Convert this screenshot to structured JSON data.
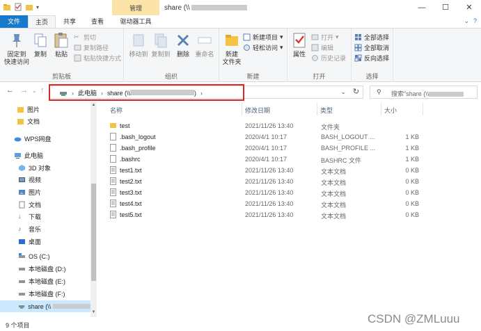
{
  "title": {
    "path_prefix": "share (\\\\",
    "context_tab": "管理"
  },
  "window_controls": {
    "minimize": "—",
    "maximize": "☐",
    "close": "✕"
  },
  "tabs": [
    {
      "label": "文件"
    },
    {
      "label": "主页"
    },
    {
      "label": "共享"
    },
    {
      "label": "查看"
    },
    {
      "label": "驱动器工具"
    }
  ],
  "ribbon": {
    "clipboard": {
      "label": "剪贴板",
      "pin": "固定到\n快速访问",
      "pin_line1": "固定到",
      "pin_line2": "快速访问",
      "copy": "复制",
      "paste": "粘贴",
      "cut": "剪切",
      "copy_path": "复制路径",
      "paste_shortcut": "粘贴快捷方式"
    },
    "organize": {
      "label": "组织",
      "move_to": "移动到",
      "copy_to": "复制到",
      "delete": "删除",
      "rename": "重命名"
    },
    "new": {
      "label": "新建",
      "new_folder_line1": "新建",
      "new_folder_line2": "文件夹",
      "new_item": "新建项目",
      "easy_access": "轻松访问"
    },
    "open": {
      "label": "打开",
      "properties": "属性",
      "open": "打开",
      "edit": "编辑",
      "history": "历史记录"
    },
    "select": {
      "label": "选择",
      "select_all": "全部选择",
      "select_none": "全部取消",
      "invert": "反向选择"
    }
  },
  "address": {
    "this_pc": "此电脑",
    "share": "share (\\\\",
    "tail": ")"
  },
  "search": {
    "placeholder": "搜索\"share (\\\\"
  },
  "nav": [
    {
      "label": "图片",
      "icon": "folder-pin-icon"
    },
    {
      "label": "文档",
      "icon": "folder-pin-icon"
    },
    {
      "label": "WPS网盘",
      "icon": "cloud-icon"
    },
    {
      "label": "此电脑",
      "icon": "computer-icon"
    },
    {
      "label": "3D 对象",
      "icon": "cube-icon"
    },
    {
      "label": "视频",
      "icon": "video-icon"
    },
    {
      "label": "图片",
      "icon": "picture-icon"
    },
    {
      "label": "文档",
      "icon": "document-icon"
    },
    {
      "label": "下载",
      "icon": "download-icon"
    },
    {
      "label": "音乐",
      "icon": "music-icon"
    },
    {
      "label": "桌面",
      "icon": "desktop-icon"
    },
    {
      "label": "OS (C:)",
      "icon": "drive-icon"
    },
    {
      "label": "本地磁盘 (D:)",
      "icon": "drive-icon"
    },
    {
      "label": "本地磁盘 (E:)",
      "icon": "drive-icon"
    },
    {
      "label": "本地磁盘 (F:)",
      "icon": "drive-icon"
    },
    {
      "label": "share (\\\\",
      "icon": "network-drive-icon"
    }
  ],
  "columns": {
    "name": "名称",
    "date": "修改日期",
    "type": "类型",
    "size": "大小"
  },
  "files": [
    {
      "name": "test",
      "date": "2021/11/26 13:40",
      "type": "文件夹",
      "size": "",
      "kind": "folder"
    },
    {
      "name": ".bash_logout",
      "date": "2020/4/1 10:17",
      "type": "BASH_LOGOUT ...",
      "size": "1 KB",
      "kind": "file"
    },
    {
      "name": ".bash_profile",
      "date": "2020/4/1 10:17",
      "type": "BASH_PROFILE ...",
      "size": "1 KB",
      "kind": "file"
    },
    {
      "name": ".bashrc",
      "date": "2020/4/1 10:17",
      "type": "BASHRC 文件",
      "size": "1 KB",
      "kind": "file"
    },
    {
      "name": "test1.txt",
      "date": "2021/11/26 13:40",
      "type": "文本文档",
      "size": "0 KB",
      "kind": "text"
    },
    {
      "name": "test2.txt",
      "date": "2021/11/26 13:40",
      "type": "文本文档",
      "size": "0 KB",
      "kind": "text"
    },
    {
      "name": "test3.txt",
      "date": "2021/11/26 13:40",
      "type": "文本文档",
      "size": "0 KB",
      "kind": "text"
    },
    {
      "name": "test4.txt",
      "date": "2021/11/26 13:40",
      "type": "文本文档",
      "size": "0 KB",
      "kind": "text"
    },
    {
      "name": "test5.txt",
      "date": "2021/11/26 13:40",
      "type": "文本文档",
      "size": "0 KB",
      "kind": "text"
    }
  ],
  "status": {
    "count": "9 个项目"
  },
  "watermark": "CSDN @ZMLuuu",
  "colors": {
    "accent": "#1979ca",
    "highlight": "#e0242a",
    "folder": "#f4c344",
    "selection": "#cce8ff"
  }
}
